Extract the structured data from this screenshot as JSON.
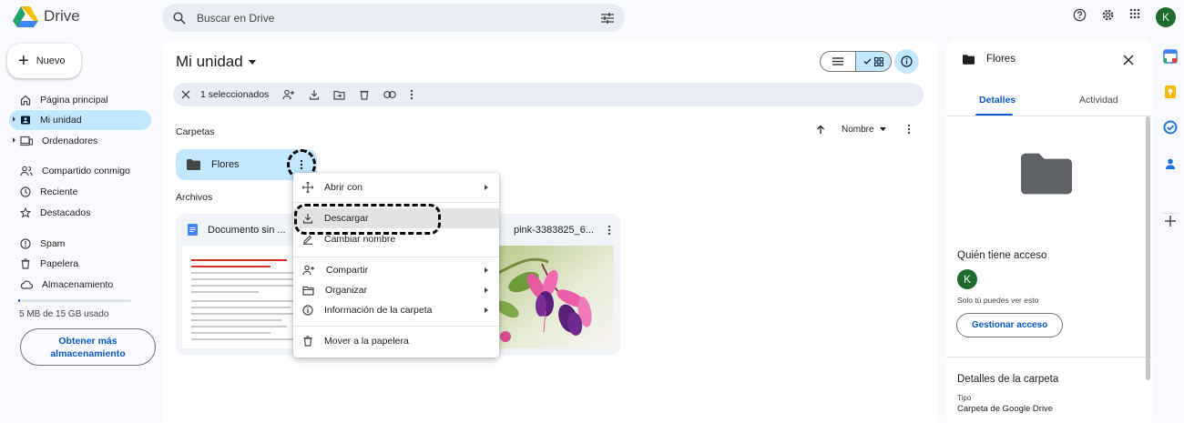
{
  "app": {
    "name": "Drive"
  },
  "search": {
    "placeholder": "Buscar en Drive"
  },
  "user": {
    "initial": "K"
  },
  "nav": {
    "new_label": "Nuevo",
    "items": [
      {
        "label": "Página principal"
      },
      {
        "label": "Mi unidad"
      },
      {
        "label": "Ordenadores"
      },
      {
        "label": "Compartido conmigo"
      },
      {
        "label": "Reciente"
      },
      {
        "label": "Destacados"
      },
      {
        "label": "Spam"
      },
      {
        "label": "Papelera"
      },
      {
        "label": "Almacenamiento"
      }
    ],
    "storage_text": "5 MB de 15 GB usado",
    "storage_fraction": 0.0003,
    "get_more": "Obtener más almacenamiento"
  },
  "main": {
    "title": "Mi unidad",
    "selection": "1 seleccionados",
    "folders_heading": "Carpetas",
    "files_heading": "Archivos",
    "sort_label": "Nombre",
    "folder": {
      "name": "Flores"
    },
    "files": [
      {
        "name": "Documento sin ...",
        "type": "doc"
      },
      {
        "name": "pink-3383825_6...",
        "type": "image"
      }
    ]
  },
  "context_menu": {
    "items": [
      {
        "label": "Abrir con",
        "icon": "open-with-icon",
        "submenu": true
      },
      {
        "label": "Descargar",
        "icon": "download-icon",
        "submenu": false
      },
      {
        "label": "Cambiar nombre",
        "icon": "rename-icon",
        "submenu": false
      },
      {
        "label": "Compartir",
        "icon": "share-icon",
        "submenu": true
      },
      {
        "label": "Organizar",
        "icon": "organize-icon",
        "submenu": true
      },
      {
        "label": "Información de la carpeta",
        "icon": "info-icon",
        "submenu": true
      },
      {
        "label": "Mover a la papelera",
        "icon": "trash-icon",
        "submenu": false
      }
    ]
  },
  "details": {
    "title": "Flores",
    "tab_details": "Detalles",
    "tab_activity": "Actividad",
    "access_title": "Quién tiene acceso",
    "only_you": "Solo tú puedes ver esto",
    "manage_access": "Gestionar acceso",
    "folder_details_title": "Detalles de la carpeta",
    "type_label": "Tipo",
    "type_value": "Carpeta de Google Drive"
  },
  "colors": {
    "accent": "#0b57d0",
    "selected": "#c2e7ff",
    "avatar": "#1e6b2f"
  }
}
